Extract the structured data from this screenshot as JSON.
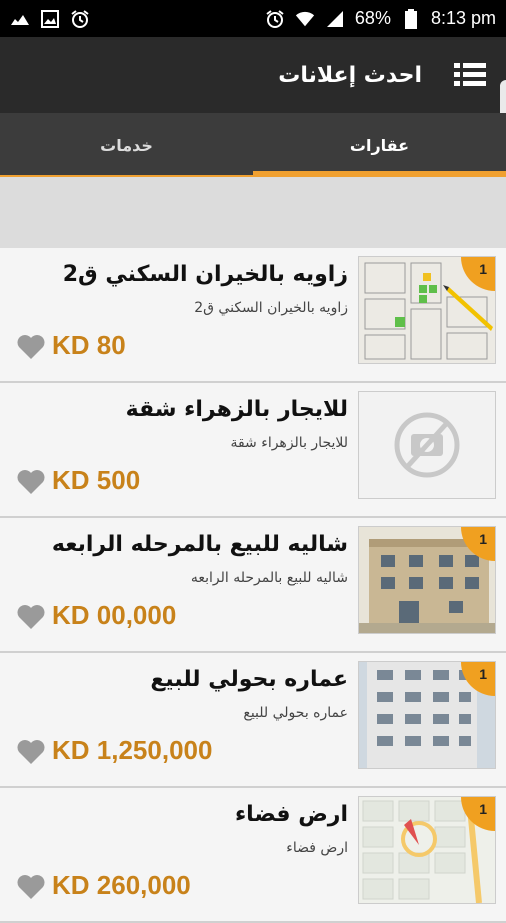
{
  "status_bar": {
    "battery": "68%",
    "time": "8:13 pm",
    "left_icons": [
      "signal-bars-icon",
      "image-icon",
      "alarm-icon"
    ],
    "right_icons": [
      "alarm-icon",
      "wifi-icon",
      "cell-signal-icon",
      "battery-icon"
    ]
  },
  "toolbar": {
    "title": "احدث إعلانات",
    "menu_icon": "hamburger-menu-icon"
  },
  "tabs": [
    {
      "label": "خدمات",
      "active": false
    },
    {
      "label": "عقارات",
      "active": true
    }
  ],
  "listings": [
    {
      "title": "زاويه بالخيران السكني ق2",
      "subtitle": "زاويه بالخيران السكني ق2",
      "price": "KD 80",
      "badge": "1",
      "image": "site-plan-image"
    },
    {
      "title": "للايجار بالزهراء شقة",
      "subtitle": "للايجار بالزهراء شقة",
      "price": "KD 500",
      "badge": "",
      "image": "no-photo-icon"
    },
    {
      "title": "شاليه للبيع بالمرحله الرابعه",
      "subtitle": "شاليه للبيع بالمرحله الرابعه",
      "price": "KD 00,000",
      "badge": "1",
      "image": "building-photo"
    },
    {
      "title": "عماره بحولي للبيع",
      "subtitle": "عماره بحولي للبيع",
      "price": "KD 1,250,000",
      "badge": "1",
      "image": "tower-photo"
    },
    {
      "title": "ارض فضاء",
      "subtitle": "ارض فضاء",
      "price": "KD 260,000",
      "badge": "1",
      "image": "map-image"
    }
  ],
  "colors": {
    "accent": "#f0a030",
    "price": "#c8821a",
    "toolbar": "#2a2a2a",
    "tabs": "#3c3c3c"
  }
}
